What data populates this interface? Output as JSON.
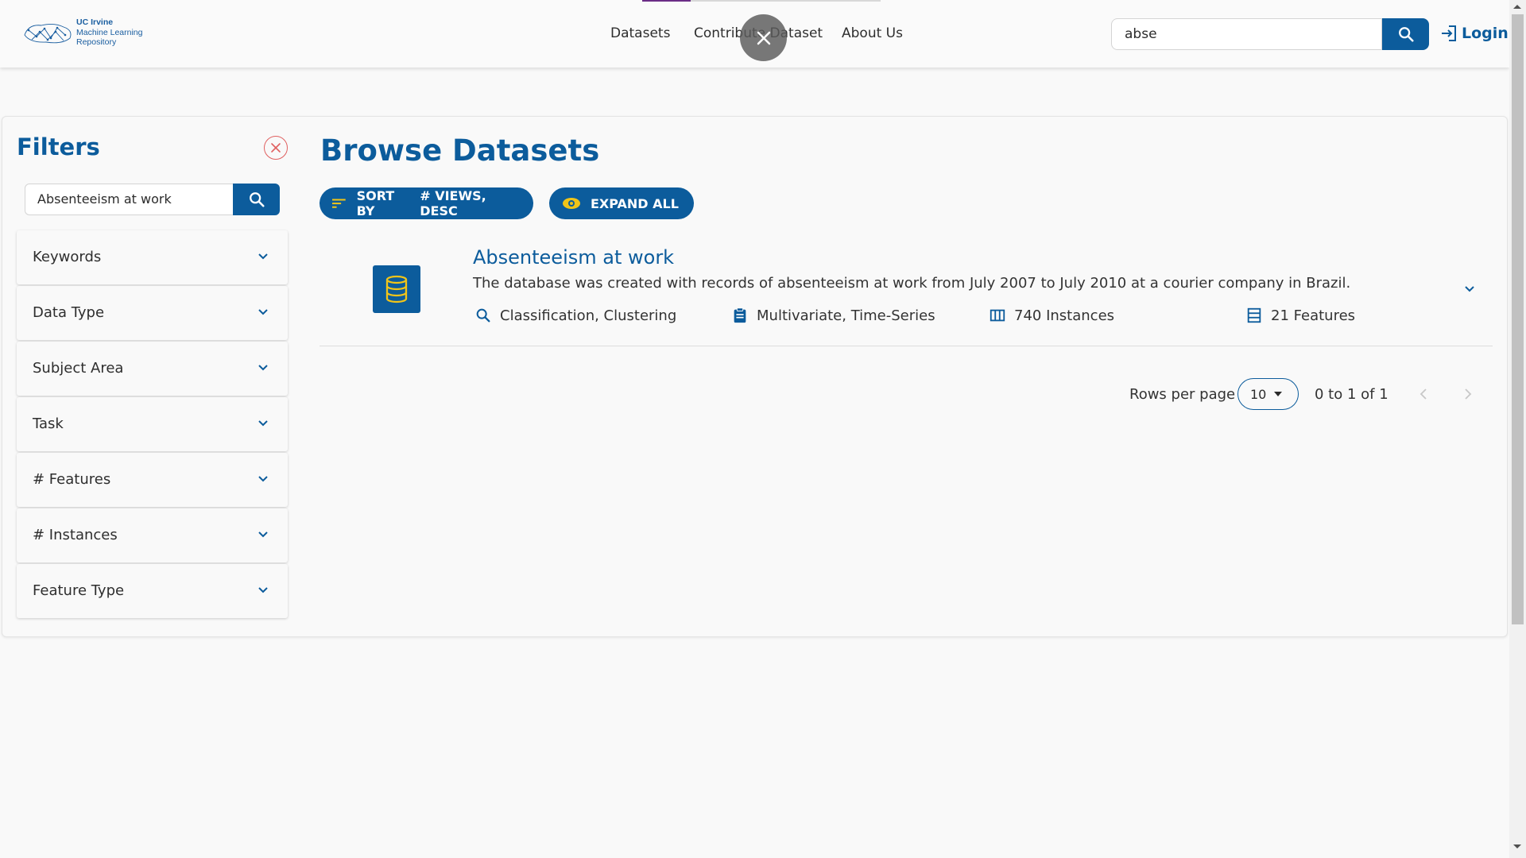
{
  "header": {
    "logo": {
      "line1": "UC Irvine",
      "line2": "Machine Learning",
      "line3": "Repository"
    },
    "nav": {
      "datasets": "Datasets",
      "contribute": "Contribute Dataset",
      "about": "About Us"
    },
    "search_value": "abse",
    "login_label": "Login"
  },
  "filters": {
    "title": "Filters",
    "search_value": "Absenteeism at work",
    "items": [
      {
        "label": "Keywords"
      },
      {
        "label": "Data Type"
      },
      {
        "label": "Subject Area"
      },
      {
        "label": "Task"
      },
      {
        "label": "# Features"
      },
      {
        "label": "# Instances"
      },
      {
        "label": "Feature Type"
      }
    ]
  },
  "main": {
    "title": "Browse Datasets",
    "sort_label": "SORT BY",
    "sort_value": "# VIEWS, DESC",
    "expand_label": "EXPAND ALL",
    "dataset": {
      "title": "Absenteeism at work",
      "description": "The database was created with records of absenteeism at work from July 2007 to July 2010 at a courier company in Brazil.",
      "task": "Classification, Clustering",
      "data_type": "Multivariate, Time-Series",
      "instances": "740 Instances",
      "features": "21 Features"
    },
    "pagination": {
      "rows_label": "Rows per page",
      "rows_value": "10",
      "range": "0 to 1 of 1"
    }
  },
  "icons": {
    "search": "search-icon",
    "login": "login-icon",
    "close": "close-icon",
    "sort": "sort-icon",
    "eye": "eye-icon",
    "database": "database-icon",
    "clipboard": "clipboard-icon",
    "columns": "columns-icon",
    "rows": "rows-icon",
    "chevron": "chevron-down-icon"
  },
  "colors": {
    "primary": "#0c5c9c",
    "accent_yellow": "#f0c419",
    "clear_red": "#e06060",
    "nav_progress": "#6b2d86"
  }
}
